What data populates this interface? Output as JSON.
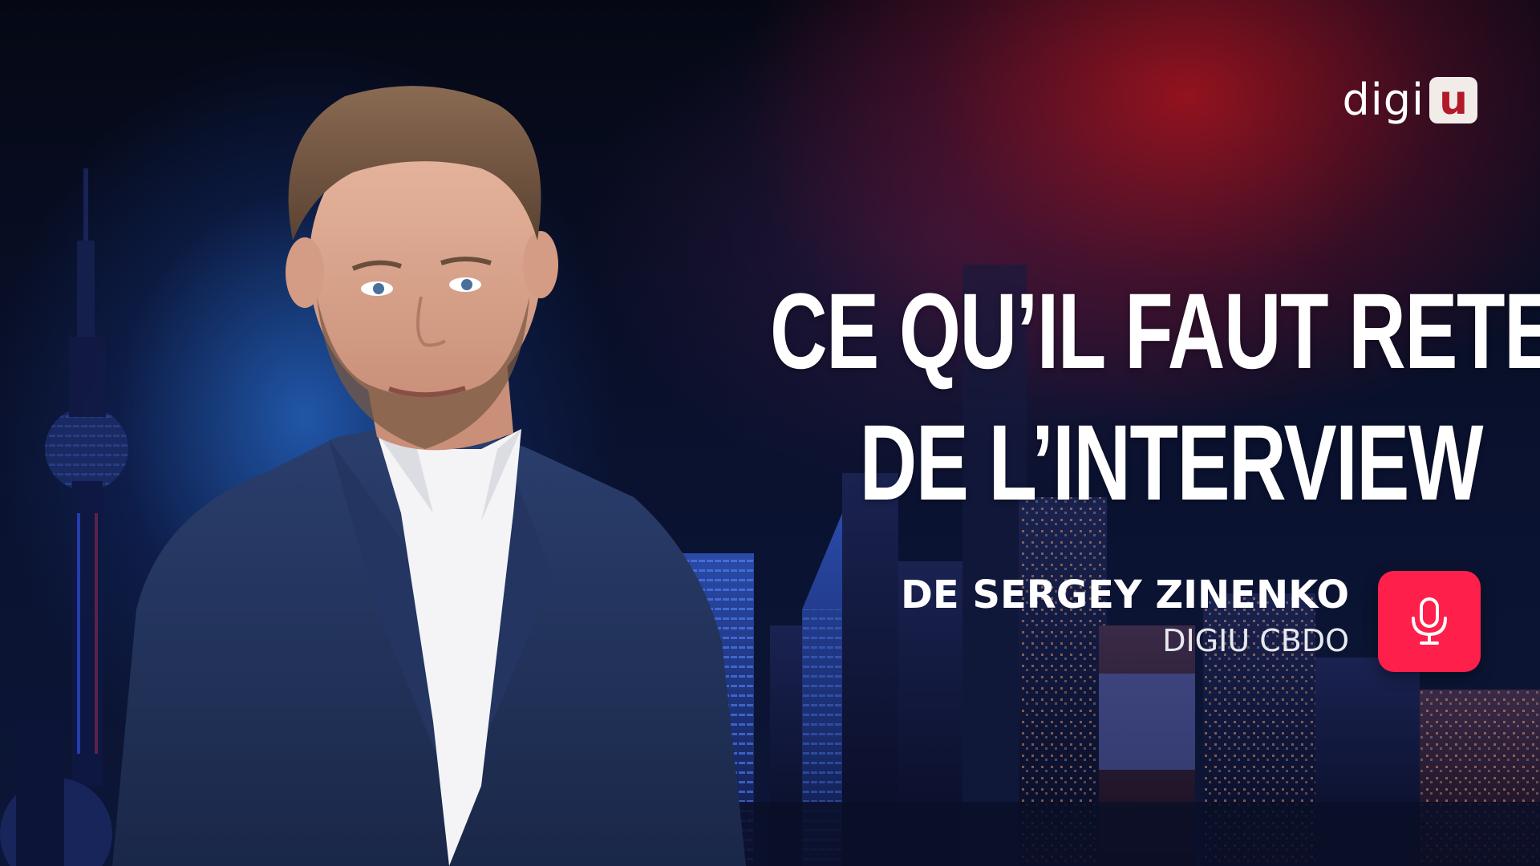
{
  "brand": {
    "logo_text": "digi",
    "logo_box_letter": "u",
    "accent_color": "#ff1f4b"
  },
  "headline": {
    "line1": "CE QU’IL FAUT RETENIR",
    "line2": "DE L’INTERVIEW"
  },
  "speaker": {
    "name": "DE SERGEY ZINENKO",
    "role": "DIGIU CBDO",
    "icon": "microphone-icon"
  }
}
